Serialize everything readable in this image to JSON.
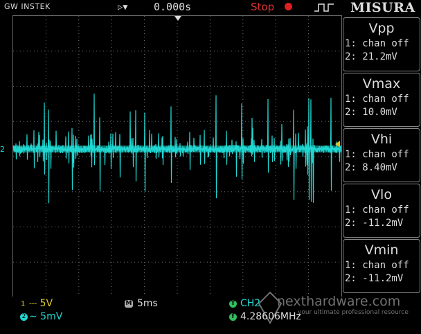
{
  "header": {
    "brand": "GW INSTEK",
    "time_offset": "0.000s",
    "run_status": "Stop"
  },
  "menu": {
    "title": "MISURA",
    "measurements": [
      {
        "name": "Vpp",
        "ch1": "1: chan off",
        "ch2": "2: 21.2mV"
      },
      {
        "name": "Vmax",
        "ch1": "1: chan off",
        "ch2": "2: 10.0mV"
      },
      {
        "name": "Vhi",
        "ch1": "1: chan off",
        "ch2": "2: 8.40mV"
      },
      {
        "name": "Vlo",
        "ch1": "1: chan off",
        "ch2": "2: -11.2mV"
      },
      {
        "name": "Vmin",
        "ch1": "1: chan off",
        "ch2": "2: -11.2mV"
      }
    ]
  },
  "screen": {
    "ch2_marker": "2",
    "trace_color": "#21d7d2"
  },
  "footer": {
    "ch1_label": "1",
    "ch1_scale": "⎓ 5V",
    "ch2_label": "2",
    "ch2_scale": "∼ 5mV",
    "timebase_label": "M",
    "timebase": "5ms",
    "trigger_label": "T",
    "trigger_source": "CH2",
    "freq_label": "f",
    "frequency": "4.28606MHz"
  },
  "watermark": {
    "name": "nexthardware.com",
    "tagline": "your ultimate professional resource"
  },
  "colors": {
    "ch1": "#e0d020",
    "ch2": "#21d7d2",
    "stop": "#e03030",
    "trigger": "#30c060"
  }
}
